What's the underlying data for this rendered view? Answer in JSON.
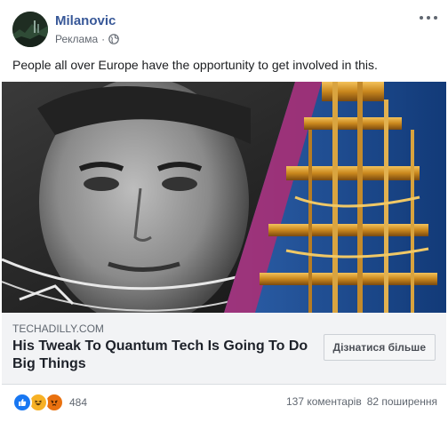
{
  "header": {
    "page_name": "Milanovic",
    "sponsored_label": "Реклама",
    "separator": "·"
  },
  "post": {
    "text": "People all over Europe have the opportunity to get involved in this."
  },
  "link": {
    "domain": "TECHADILLY.COM",
    "headline": "His Tweak To Quantum Tech Is Going To Do Big Things",
    "cta_label": "Дізнатися більше"
  },
  "footer": {
    "reaction_icons": [
      "like-icon",
      "haha-icon",
      "angry-icon"
    ],
    "reaction_count": "484",
    "comments": "137 коментарів",
    "shares": "82 поширення"
  },
  "colors": {
    "brand_name": "#385898",
    "like": "#1877f2",
    "haha": "#f7b125",
    "angry": "#e9710f"
  }
}
